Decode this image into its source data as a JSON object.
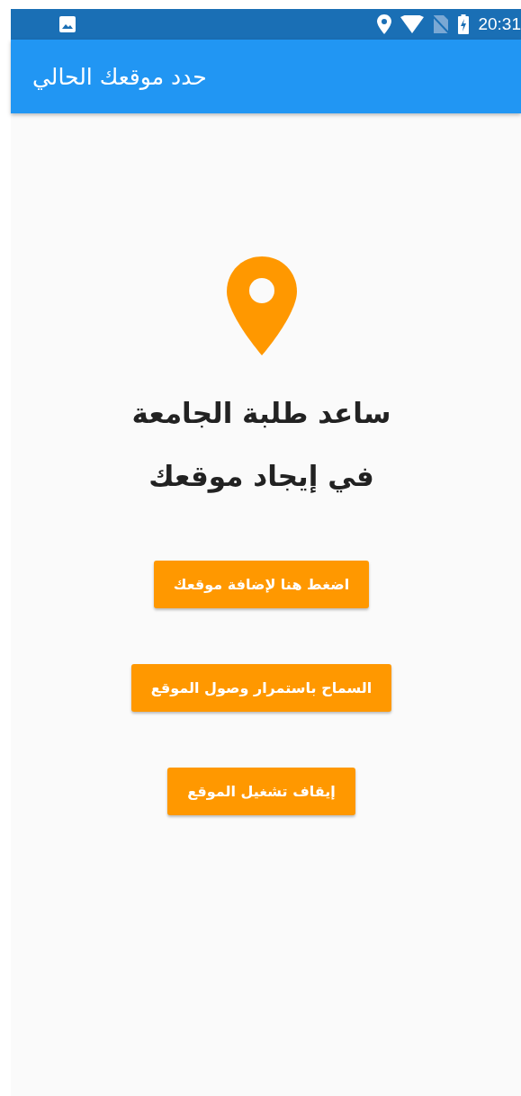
{
  "status_bar": {
    "time": "20:31"
  },
  "app_bar": {
    "title": "حدد موقعك الحالي"
  },
  "heading": [
    "ساعد طلبة الجامعة",
    "في إيجاد موقعك"
  ],
  "buttons": [
    {
      "label": "اضغط هنا لإضافة موقعك"
    },
    {
      "label": "السماح باستمرار وصول الموقع"
    },
    {
      "label": "إيقاف تشغيل الموقع"
    }
  ]
}
